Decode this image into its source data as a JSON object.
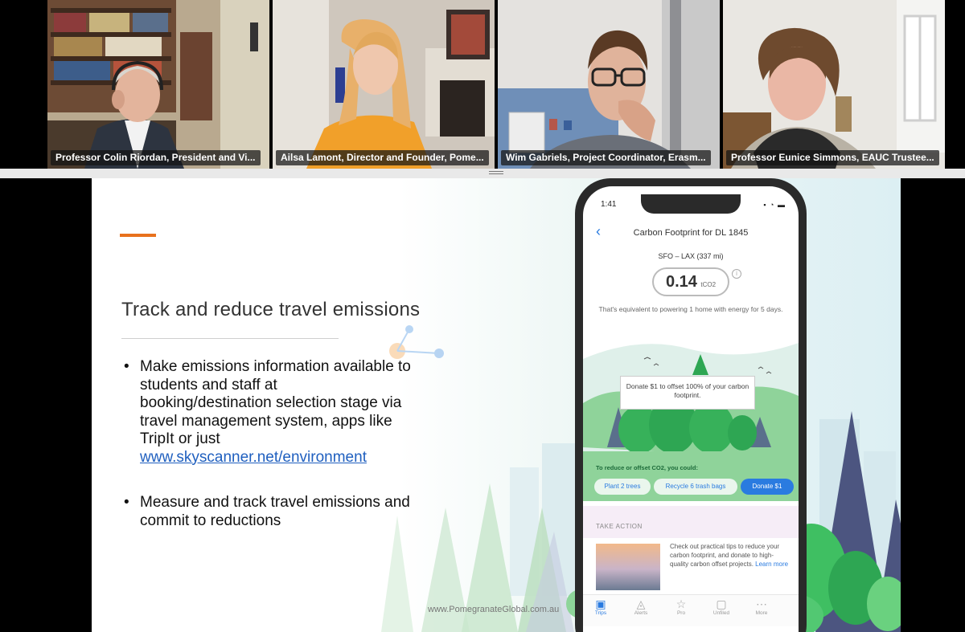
{
  "participants": [
    {
      "name": "Professor Colin Riordan, President and Vi...",
      "active": false
    },
    {
      "name": "Ailsa Lamont, Director and Founder, Pome...",
      "active": true
    },
    {
      "name": "Wim Gabriels, Project Coordinator, Erasm...",
      "active": false
    },
    {
      "name": "Professor Eunice Simmons, EAUC Trustee..."
    }
  ],
  "slide": {
    "title": "Track and reduce travel emissions",
    "bullet_char": "•",
    "bullets": [
      {
        "text": "Make emissions information available to students and staff at booking/destination selection stage via travel management system, apps like TripIt or just ",
        "link": "www.skyscanner.net/environment"
      },
      {
        "text": "Measure and track travel emissions and commit to reductions"
      }
    ],
    "footer": "www.PomegranateGlobal.com.au",
    "colors": {
      "accent": "#e8711d",
      "link": "#1f5fbf"
    }
  },
  "phone": {
    "time": "1:41",
    "status_icons": "▪ ◔ ▬",
    "back_icon": "chevron-left-icon",
    "back_glyph": "‹",
    "header": "Carbon Footprint for DL 1845",
    "route": "SFO – LAX  (337 mi)",
    "value": "0.14",
    "unit": "tCO2",
    "info_glyph": "i",
    "equivalent": "That's equivalent to powering 1 home with energy for 5 days.",
    "donate_prompt": "Donate $1 to offset 100% of your carbon footprint.",
    "reduce_label": "To reduce or offset CO2, you could:",
    "chips": [
      "Plant 2 trees",
      "Recycle 6 trash bags",
      "Donate $1"
    ],
    "take_action_label": "TAKE ACTION",
    "tips": "Check out practical tips to reduce your carbon footprint, and donate to high-quality carbon offset projects.",
    "learn_more": "Learn more",
    "tabs": [
      {
        "label": "Trips",
        "icon": "briefcase-icon",
        "glyph": "▣",
        "active": true
      },
      {
        "label": "Alerts",
        "icon": "bell-icon",
        "glyph": "◬"
      },
      {
        "label": "Pro",
        "icon": "star-icon",
        "glyph": "☆"
      },
      {
        "label": "Unfiled",
        "icon": "document-icon",
        "glyph": "▢"
      },
      {
        "label": "More",
        "icon": "more-icon",
        "glyph": "⋯"
      }
    ]
  }
}
